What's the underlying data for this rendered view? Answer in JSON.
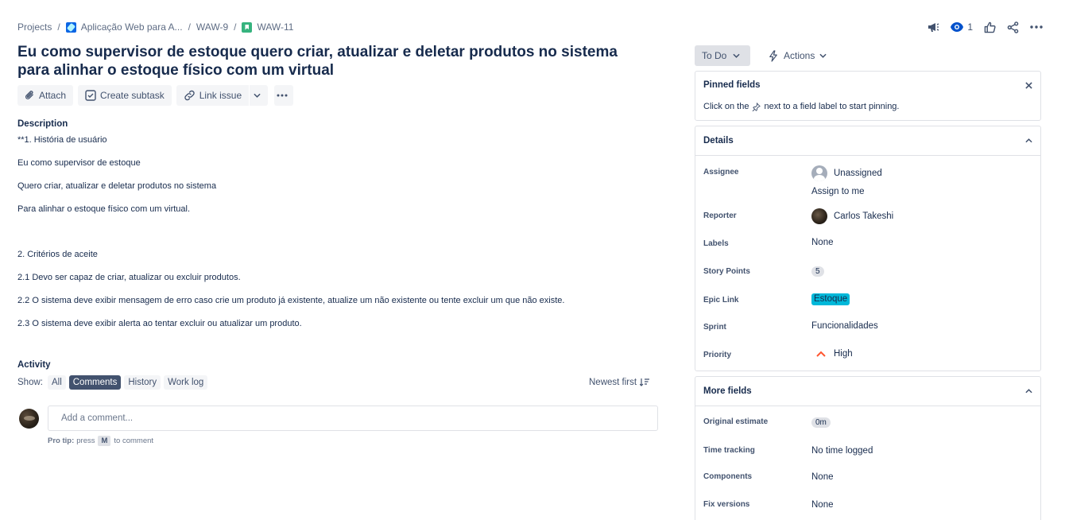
{
  "breadcrumb": {
    "projects": "Projects",
    "project": "Aplicação Web para A...",
    "parent": "WAW-9",
    "issue": "WAW-11"
  },
  "top_actions": {
    "watch_count": "1"
  },
  "title": "Eu como supervisor de estoque quero criar, atualizar e deletar produtos no sistema para alinhar o estoque físico com um virtual",
  "toolbar": {
    "attach": "Attach",
    "create_subtask": "Create subtask",
    "link_issue": "Link issue"
  },
  "description": {
    "heading": "Description",
    "lines": [
      "**1. História de usuário",
      "Eu como supervisor de estoque",
      "Quero criar, atualizar e deletar produtos no sistema",
      "Para alinhar o estoque físico com um virtual.",
      "2. Critérios de aceite",
      "2.1 Devo ser capaz de criar, atualizar ou excluir produtos.",
      "2.2 O sistema deve exibir mensagem de erro caso crie um produto já existente, atualize um não existente ou tente excluir um que não existe.",
      "2.3 O sistema deve exibir alerta ao tentar excluir ou atualizar um produto."
    ]
  },
  "activity": {
    "heading": "Activity",
    "show_label": "Show:",
    "filters": [
      "All",
      "Comments",
      "History",
      "Work log"
    ],
    "active_filter": "Comments",
    "sort": "Newest first",
    "comment_placeholder": "Add a comment...",
    "protip_label": "Pro tip:",
    "protip_press": "press",
    "protip_key": "M",
    "protip_rest": "to comment"
  },
  "status": {
    "label": "To Do",
    "actions": "Actions"
  },
  "pinned": {
    "heading": "Pinned fields",
    "msg_before": "Click on the",
    "msg_after": "next to a field label to start pinning."
  },
  "details": {
    "heading": "Details",
    "assignee_label": "Assignee",
    "assignee": "Unassigned",
    "assign_to_me": "Assign to me",
    "reporter_label": "Reporter",
    "reporter": "Carlos Takeshi",
    "labels_label": "Labels",
    "labels": "None",
    "story_points_label": "Story Points",
    "story_points": "5",
    "epic_label": "Epic Link",
    "epic": "Estoque",
    "sprint_label": "Sprint",
    "sprint": "Funcionalidades",
    "priority_label": "Priority",
    "priority": "High"
  },
  "more_fields": {
    "heading": "More fields",
    "original_estimate_label": "Original estimate",
    "original_estimate": "0m",
    "time_tracking_label": "Time tracking",
    "time_tracking": "No time logged",
    "components_label": "Components",
    "components": "None",
    "fix_versions_label": "Fix versions",
    "fix_versions": "None"
  },
  "colors": {
    "epic": "#00b8d9",
    "priority_high": "#ff5630",
    "active_filter": "#42526e",
    "link": "#0052cc"
  }
}
